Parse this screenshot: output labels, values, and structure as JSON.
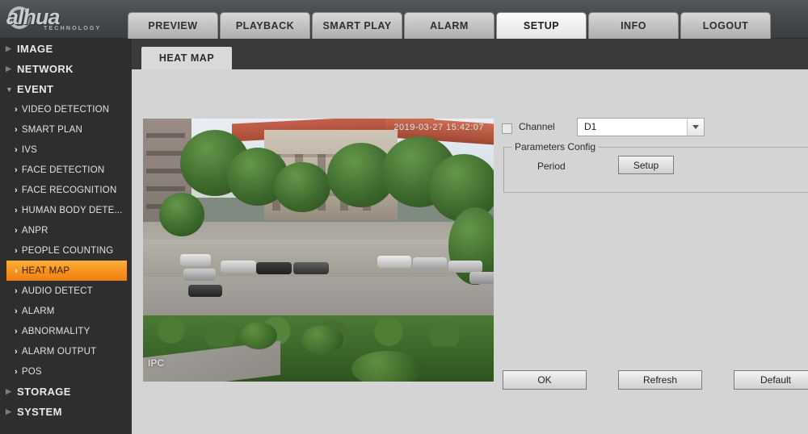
{
  "brand": {
    "name": "alhua",
    "tagline": "TECHNOLOGY"
  },
  "nav": {
    "tabs": [
      {
        "label": "PREVIEW",
        "active": false
      },
      {
        "label": "PLAYBACK",
        "active": false
      },
      {
        "label": "SMART PLAY",
        "active": false
      },
      {
        "label": "ALARM",
        "active": false
      },
      {
        "label": "SETUP",
        "active": true
      },
      {
        "label": "INFO",
        "active": false
      },
      {
        "label": "LOGOUT",
        "active": false
      }
    ]
  },
  "sidebar": {
    "groups": [
      {
        "label": "IMAGE",
        "expanded": false,
        "triangle": "▶"
      },
      {
        "label": "NETWORK",
        "expanded": false,
        "triangle": "▶"
      },
      {
        "label": "EVENT",
        "expanded": true,
        "triangle": "▼"
      }
    ],
    "event_items": [
      {
        "label": "VIDEO DETECTION",
        "selected": false
      },
      {
        "label": "SMART PLAN",
        "selected": false
      },
      {
        "label": "IVS",
        "selected": false
      },
      {
        "label": "FACE DETECTION",
        "selected": false
      },
      {
        "label": "FACE RECOGNITION",
        "selected": false
      },
      {
        "label": "HUMAN BODY DETE...",
        "selected": false
      },
      {
        "label": "ANPR",
        "selected": false
      },
      {
        "label": "PEOPLE COUNTING",
        "selected": false
      },
      {
        "label": "HEAT MAP",
        "selected": true
      },
      {
        "label": "AUDIO DETECT",
        "selected": false
      },
      {
        "label": "ALARM",
        "selected": false
      },
      {
        "label": "ABNORMALITY",
        "selected": false
      },
      {
        "label": "ALARM OUTPUT",
        "selected": false
      },
      {
        "label": "POS",
        "selected": false
      }
    ],
    "footer_groups": [
      {
        "label": "STORAGE",
        "expanded": false,
        "triangle": "▶"
      },
      {
        "label": "SYSTEM",
        "expanded": false,
        "triangle": "▶"
      }
    ],
    "item_arrow": "›"
  },
  "page": {
    "tab_label": "HEAT MAP"
  },
  "video": {
    "osd_channel_name": "IPC",
    "osd_timestamp": "2019-03-27 15:42:07"
  },
  "form": {
    "channel_label": "Channel",
    "channel_checked": false,
    "channel_value": "D1",
    "channel_options": [
      "D1"
    ],
    "fieldset_legend": "Parameters Config",
    "period_label": "Period",
    "setup_button": "Setup"
  },
  "actions": {
    "ok": "OK",
    "refresh": "Refresh",
    "default": "Default"
  },
  "colors": {
    "accent_orange": "#f79520",
    "sidebar_bg": "#2e2e2e",
    "panel_bg": "#d4d4d4",
    "header_bg": "#46494d"
  }
}
